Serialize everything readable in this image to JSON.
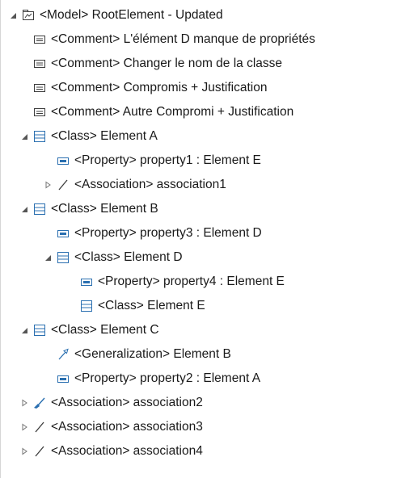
{
  "tree": {
    "items": [
      {
        "text": "<Model> RootElement - Updated",
        "icon": "model-icon",
        "toggle": "expanded"
      },
      {
        "text": "<Comment> L'élément D manque de propriétés",
        "icon": "comment-icon",
        "toggle": "none"
      },
      {
        "text": "<Comment> Changer le nom de la classe",
        "icon": "comment-icon",
        "toggle": "none"
      },
      {
        "text": "<Comment> Compromis + Justification",
        "icon": "comment-icon",
        "toggle": "none"
      },
      {
        "text": "<Comment> Autre Compromi + Justification",
        "icon": "comment-icon",
        "toggle": "none"
      },
      {
        "text": "<Class> Element A",
        "icon": "class-icon",
        "toggle": "expanded"
      },
      {
        "text": "<Property> property1 : Element E",
        "icon": "property-icon",
        "toggle": "none"
      },
      {
        "text": "<Association> association1",
        "icon": "association-icon",
        "toggle": "collapsed"
      },
      {
        "text": "<Class> Element B",
        "icon": "class-icon",
        "toggle": "expanded"
      },
      {
        "text": "<Property> property3 : Element D",
        "icon": "property-icon",
        "toggle": "none"
      },
      {
        "text": "<Class> Element D",
        "icon": "class-icon",
        "toggle": "expanded"
      },
      {
        "text": "<Property> property4 : Element E",
        "icon": "property-icon",
        "toggle": "none"
      },
      {
        "text": "<Class> Element E",
        "icon": "class-icon",
        "toggle": "none"
      },
      {
        "text": "<Class> Element C",
        "icon": "class-icon",
        "toggle": "expanded"
      },
      {
        "text": "<Generalization> Element B",
        "icon": "generalization-icon",
        "toggle": "none"
      },
      {
        "text": "<Property> property2 : Element A",
        "icon": "property-icon",
        "toggle": "none"
      },
      {
        "text": "<Association> association2",
        "icon": "association-navigable-icon",
        "toggle": "collapsed"
      },
      {
        "text": "<Association> association3",
        "icon": "association-icon",
        "toggle": "collapsed"
      },
      {
        "text": "<Association> association4",
        "icon": "association-icon",
        "toggle": "collapsed"
      }
    ]
  }
}
